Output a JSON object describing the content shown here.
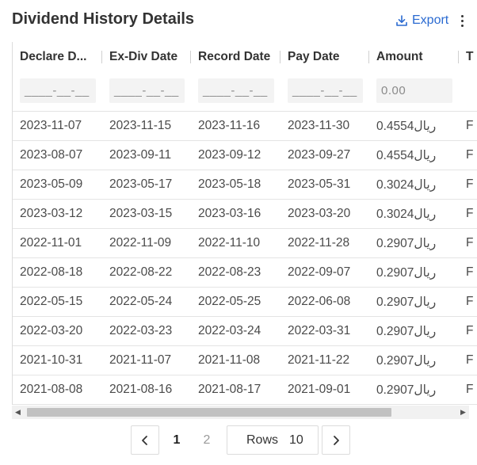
{
  "header": {
    "title": "Dividend History Details",
    "export_label": "Export",
    "accent_color": "#2a6ad1",
    "icons": {
      "export": "download-icon",
      "more": "more-vertical-icon"
    }
  },
  "table": {
    "columns": [
      {
        "label": "Declare D..."
      },
      {
        "label": "Ex-Div Date"
      },
      {
        "label": "Record Date"
      },
      {
        "label": "Pay Date"
      },
      {
        "label": "Amount"
      },
      {
        "label": "T"
      }
    ],
    "filters": [
      "____-__-__",
      "____-__-__",
      "____-__-__",
      "____-__-__",
      "0.00"
    ],
    "rows": [
      [
        "2023-11-07",
        "2023-11-15",
        "2023-11-16",
        "2023-11-30",
        "0.4554ريال",
        "F"
      ],
      [
        "2023-08-07",
        "2023-09-11",
        "2023-09-12",
        "2023-09-27",
        "0.4554ريال",
        "F"
      ],
      [
        "2023-05-09",
        "2023-05-17",
        "2023-05-18",
        "2023-05-31",
        "0.3024ريال",
        "F"
      ],
      [
        "2023-03-12",
        "2023-03-15",
        "2023-03-16",
        "2023-03-20",
        "0.3024ريال",
        "F"
      ],
      [
        "2022-11-01",
        "2022-11-09",
        "2022-11-10",
        "2022-11-28",
        "0.2907ريال",
        "F"
      ],
      [
        "2022-08-18",
        "2022-08-22",
        "2022-08-23",
        "2022-09-07",
        "0.2907ريال",
        "F"
      ],
      [
        "2022-05-15",
        "2022-05-24",
        "2022-05-25",
        "2022-06-08",
        "0.2907ريال",
        "F"
      ],
      [
        "2022-03-20",
        "2022-03-23",
        "2022-03-24",
        "2022-03-31",
        "0.2907ريال",
        "F"
      ],
      [
        "2021-10-31",
        "2021-11-07",
        "2021-11-08",
        "2021-11-22",
        "0.2907ريال",
        "F"
      ],
      [
        "2021-08-08",
        "2021-08-16",
        "2021-08-17",
        "2021-09-01",
        "0.2907ريال",
        "F"
      ]
    ]
  },
  "scrollbar": {
    "left_arrow": "◀",
    "right_arrow": "▶"
  },
  "pagination": {
    "prev_icon": "chevron-left-icon",
    "next_icon": "chevron-right-icon",
    "pages": [
      "1",
      "2"
    ],
    "current_page": "1",
    "rows_label": "Rows",
    "rows_value": "10"
  }
}
